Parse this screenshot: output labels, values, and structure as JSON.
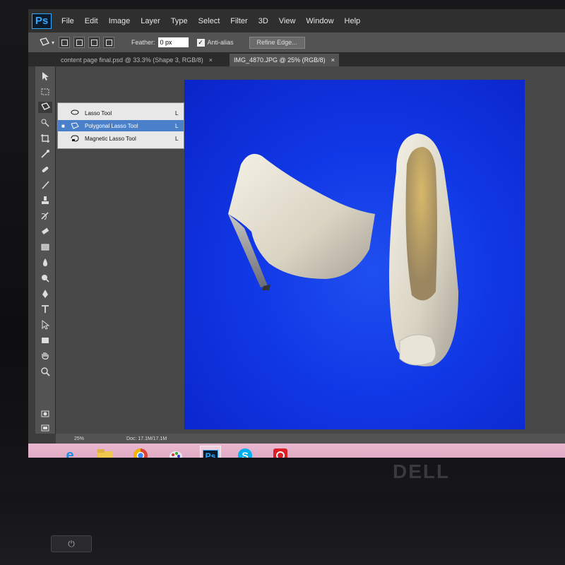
{
  "app": {
    "logo": "Ps"
  },
  "menu": [
    "File",
    "Edit",
    "Image",
    "Layer",
    "Type",
    "Select",
    "Filter",
    "3D",
    "View",
    "Window",
    "Help"
  ],
  "options": {
    "tool_icon": "polygonal-lasso-icon",
    "feather_label": "Feather:",
    "feather_value": "0 px",
    "antialias_label": "Anti-alias",
    "antialias_checked": true,
    "refine_edge_label": "Refine Edge..."
  },
  "tabs": [
    {
      "title": "content page final.psd @ 33.3% (Shape 3, RGB/8)",
      "close": "×"
    },
    {
      "title": "IMG_4870.JPG @ 25% (RGB/8)",
      "close": "×",
      "active": true
    }
  ],
  "tools": [
    "move",
    "marquee",
    "lasso",
    "quick-select",
    "crop",
    "eyedropper",
    "healing",
    "brush",
    "stamp",
    "history-brush",
    "eraser",
    "gradient",
    "blur",
    "dodge",
    "pen",
    "type",
    "path-select",
    "shape",
    "hand",
    "zoom"
  ],
  "flyout": {
    "items": [
      {
        "label": "Lasso Tool",
        "key": "L",
        "icon": "lasso-icon",
        "selected": false
      },
      {
        "label": "Polygonal Lasso Tool",
        "key": "L",
        "icon": "polygonal-lasso-icon",
        "selected": true
      },
      {
        "label": "Magnetic Lasso Tool",
        "key": "L",
        "icon": "magnetic-lasso-icon",
        "selected": false
      }
    ]
  },
  "status": {
    "zoom": "25%",
    "doc": "Doc: 17.1M/17.1M"
  },
  "colors": {
    "foreground": "#0a22d8",
    "background": "#ffffff",
    "canvas": "#1138e6"
  },
  "taskbar": {
    "items": [
      "internet-explorer-icon",
      "file-explorer-icon",
      "chrome-icon",
      "paint-icon",
      "photoshop-icon",
      "skype-icon",
      "adobe-cc-icon"
    ],
    "ps_label": "Ps"
  },
  "hardware": {
    "brand": "DELL"
  }
}
